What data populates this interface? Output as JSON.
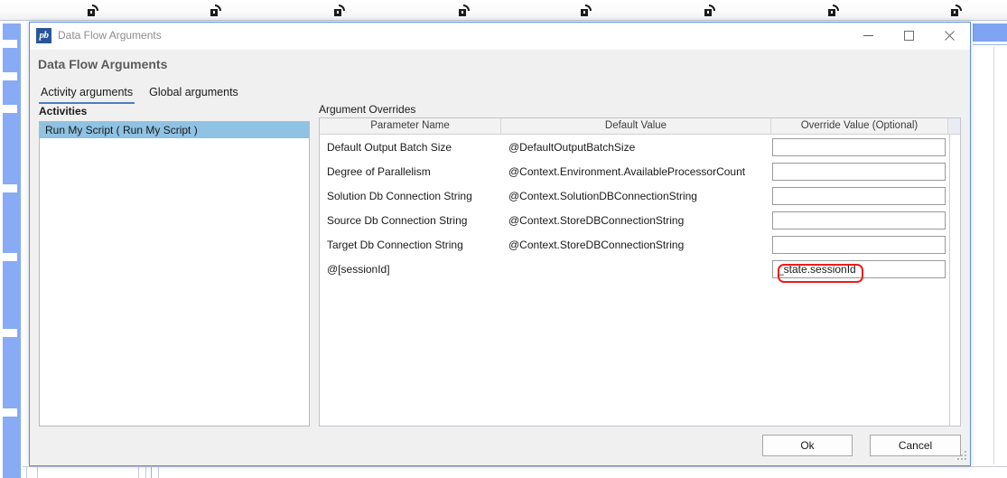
{
  "background": {
    "padlock_icon": "open-padlock-icon",
    "padlock_positions": [
      97,
      233,
      370,
      508,
      643,
      780,
      917,
      1053
    ],
    "blue_column_color": "#87abf5",
    "tick_positions": [
      44,
      80,
      116,
      204,
      280,
      364,
      452
    ]
  },
  "window": {
    "icon_text": "pb",
    "icon_name": "powerbuilder-app-icon",
    "title": "Data Flow Arguments",
    "controls": {
      "minimize": "minimize-icon",
      "maximize": "maximize-icon",
      "close": "close-icon"
    },
    "accent_color": "#5b8fd6"
  },
  "dialog": {
    "heading": "Data Flow Arguments",
    "tabs": [
      {
        "label": "Activity arguments",
        "active": true
      },
      {
        "label": "Global arguments",
        "active": false
      }
    ],
    "activities": {
      "label": "Activities",
      "items": [
        {
          "label": "Run My Script  ( Run My Script )",
          "selected": true
        }
      ]
    },
    "argument_overrides": {
      "label": "Argument Overrides",
      "columns": [
        "Parameter Name",
        "Default Value",
        "Override Value (Optional)"
      ],
      "rows": [
        {
          "parameter": "Default Output Batch Size",
          "default": "@DefaultOutputBatchSize",
          "override": ""
        },
        {
          "parameter": "Degree of Parallelism",
          "default": "@Context.Environment.AvailableProcessorCount",
          "override": ""
        },
        {
          "parameter": "Solution Db Connection String",
          "default": "@Context.SolutionDBConnectionString",
          "override": ""
        },
        {
          "parameter": "Source Db Connection String",
          "default": "@Context.StoreDBConnectionString",
          "override": ""
        },
        {
          "parameter": "Target Db Connection String",
          "default": "@Context.StoreDBConnectionString",
          "override": ""
        },
        {
          "parameter": "@[sessionId]",
          "default": "",
          "override": "_state.sessionId",
          "highlighted": true
        }
      ]
    },
    "buttons": {
      "ok": "Ok",
      "cancel": "Cancel"
    },
    "annotation_color": "#ef1c19",
    "selection_color": "#8fc2e3"
  }
}
